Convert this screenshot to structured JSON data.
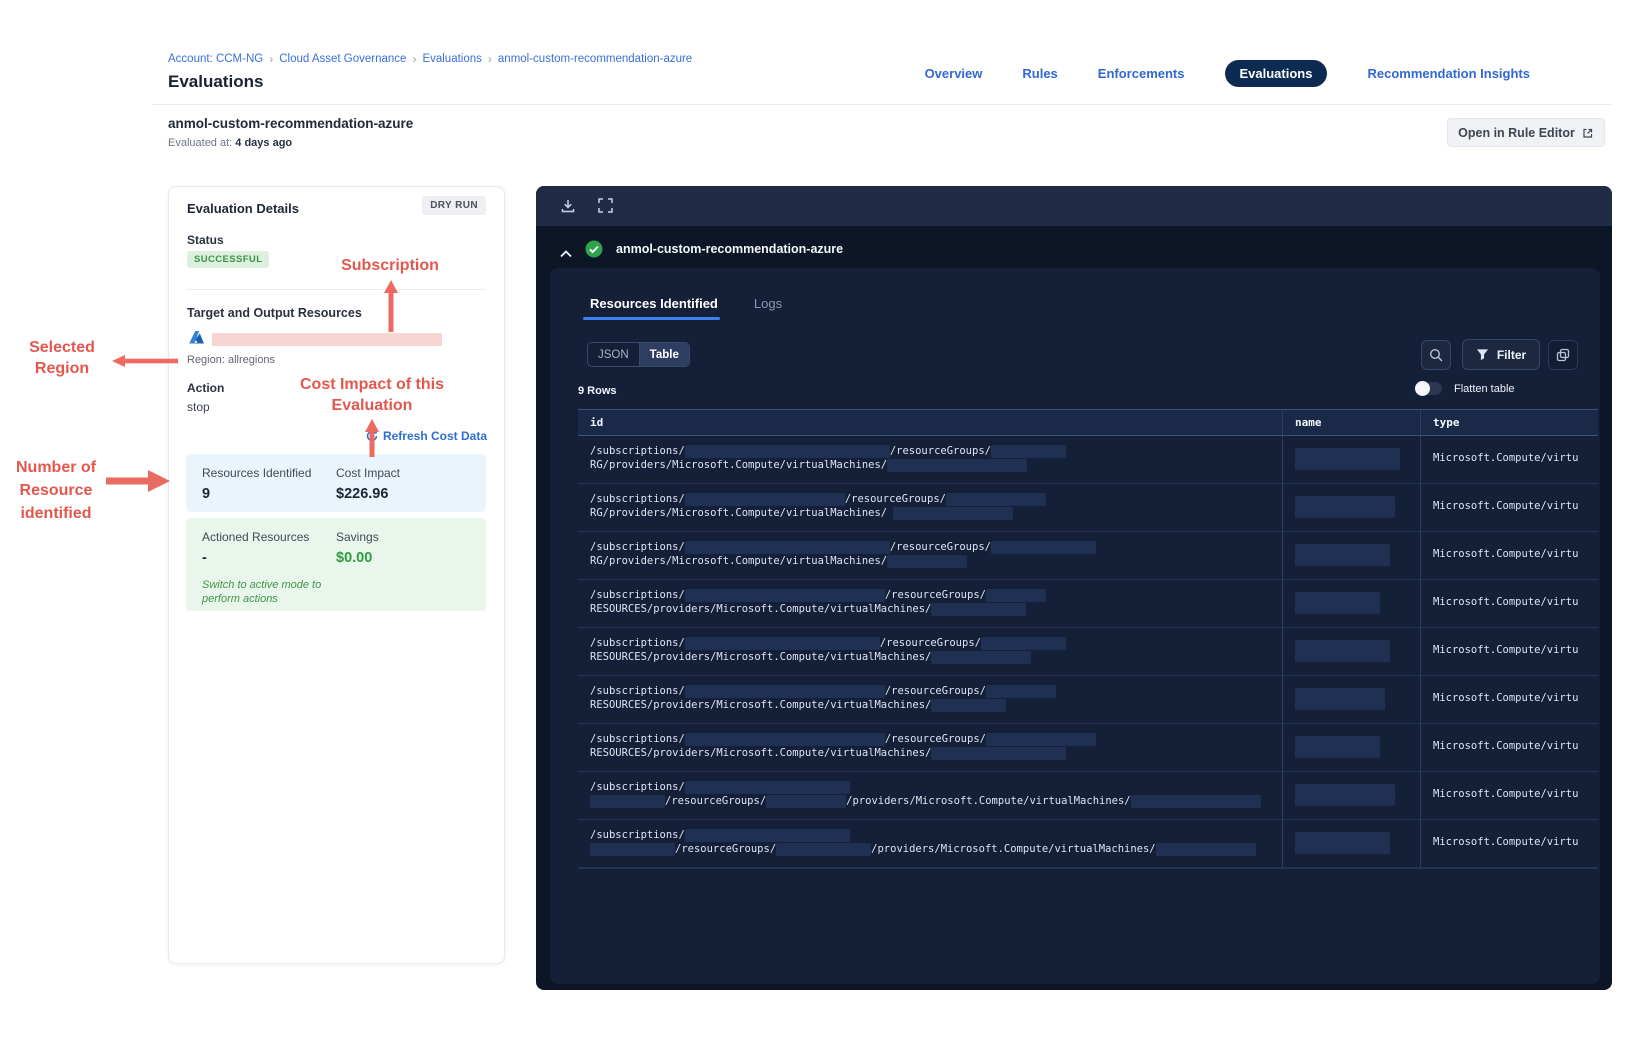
{
  "breadcrumb": {
    "items": [
      "Account: CCM-NG",
      "Cloud Asset Governance",
      "Evaluations",
      "anmol-custom-recommendation-azure"
    ],
    "separator": "›"
  },
  "page_title": "Evaluations",
  "nav": {
    "tabs": [
      {
        "label": "Overview",
        "active": false
      },
      {
        "label": "Rules",
        "active": false
      },
      {
        "label": "Enforcements",
        "active": false
      },
      {
        "label": "Evaluations",
        "active": true
      },
      {
        "label": "Recommendation Insights",
        "active": false
      }
    ]
  },
  "subheader": {
    "title": "anmol-custom-recommendation-azure",
    "evaluated_label": "Evaluated at:",
    "evaluated_value": "4 days ago",
    "open_rule_editor_label": "Open in Rule Editor"
  },
  "details_card": {
    "title": "Evaluation Details",
    "mode_badge": "DRY RUN",
    "status_label": "Status",
    "status_value": "SUCCESSFUL",
    "target_label": "Target and Output Resources",
    "region_text": "Region: allregions",
    "action_label": "Action",
    "action_value": "stop",
    "refresh_link": "Refresh Cost Data",
    "resources_identified_label": "Resources Identified",
    "resources_identified_value": "9",
    "cost_impact_label": "Cost Impact",
    "cost_impact_value": "$226.96",
    "actioned_label": "Actioned Resources",
    "actioned_value": "-",
    "savings_label": "Savings",
    "savings_value": "$0.00",
    "switch_note": "Switch to active mode to perform actions"
  },
  "annotations": {
    "color": "#e4574e",
    "subscription": "Subscription",
    "selected_region": "Selected Region",
    "cost_impact": "Cost Impact of this Evaluation",
    "resources_identified": "Number of Resource identified"
  },
  "results_panel": {
    "title": "anmol-custom-recommendation-azure",
    "tabs": {
      "resources": "Resources Identified",
      "logs": "Logs"
    },
    "view_toggle": {
      "json": "JSON",
      "table": "Table"
    },
    "filter_label": "Filter",
    "rows_count": "9 Rows",
    "flatten_label": "Flatten table",
    "table": {
      "columns": [
        "id",
        "name",
        "type"
      ],
      "type_value": "Microsoft.Compute/virtu",
      "rows": [
        {
          "id1": [
            {
              "t": "/subscriptions/"
            },
            {
              "b": 205
            },
            {
              "t": "/resourceGroups/"
            },
            {
              "b": 75
            }
          ],
          "id2": [
            {
              "t": "RG/providers/Microsoft.Compute/virtualMachines/"
            },
            {
              "b": 140
            }
          ],
          "name_b": 105
        },
        {
          "id1": [
            {
              "t": "/subscriptions/"
            },
            {
              "b": 160
            },
            {
              "t": "/resourceGroups/"
            },
            {
              "b": 100
            }
          ],
          "id2": [
            {
              "t": "RG/providers/Microsoft.Compute/virtualMachines/ "
            },
            {
              "b": 120
            }
          ],
          "name_b": 100
        },
        {
          "id1": [
            {
              "t": "/subscriptions/"
            },
            {
              "b": 205
            },
            {
              "t": "/resourceGroups/"
            },
            {
              "b": 105
            }
          ],
          "id2": [
            {
              "t": "RG/providers/Microsoft.Compute/virtualMachines/"
            },
            {
              "b": 80
            }
          ],
          "name_b": 95
        },
        {
          "id1": [
            {
              "t": "/subscriptions/"
            },
            {
              "b": 200
            },
            {
              "t": "/resourceGroups/"
            },
            {
              "b": 60
            }
          ],
          "id2": [
            {
              "t": "RESOURCES/providers/Microsoft.Compute/virtualMachines/"
            },
            {
              "b": 95
            }
          ],
          "name_b": 85
        },
        {
          "id1": [
            {
              "t": "/subscriptions/"
            },
            {
              "b": 195
            },
            {
              "t": "/resourceGroups/"
            },
            {
              "b": 85
            }
          ],
          "id2": [
            {
              "t": "RESOURCES/providers/Microsoft.Compute/virtualMachines/"
            },
            {
              "b": 100
            }
          ],
          "name_b": 95
        },
        {
          "id1": [
            {
              "t": "/subscriptions/"
            },
            {
              "b": 200
            },
            {
              "t": "/resourceGroups/"
            },
            {
              "b": 70
            }
          ],
          "id2": [
            {
              "t": "RESOURCES/providers/Microsoft.Compute/virtualMachines/"
            },
            {
              "b": 75
            }
          ],
          "name_b": 90
        },
        {
          "id1": [
            {
              "t": "/subscriptions/"
            },
            {
              "b": 200
            },
            {
              "t": "/resourceGroups/"
            },
            {
              "b": 110
            }
          ],
          "id2": [
            {
              "t": "RESOURCES/providers/Microsoft.Compute/virtualMachines/"
            },
            {
              "b": 135
            }
          ],
          "name_b": 85
        },
        {
          "id1": [
            {
              "t": "/subscriptions/"
            },
            {
              "b": 165
            }
          ],
          "id2": [
            {
              "b": 75
            },
            {
              "t": "/resourceGroups/"
            },
            {
              "b": 80
            },
            {
              "t": "/providers/Microsoft.Compute/virtualMachines/"
            },
            {
              "b": 130
            }
          ],
          "name_b": 100
        },
        {
          "id1": [
            {
              "t": "/subscriptions/"
            },
            {
              "b": 165
            }
          ],
          "id2": [
            {
              "b": 85
            },
            {
              "t": "/resourceGroups/"
            },
            {
              "b": 95
            },
            {
              "t": "/providers/Microsoft.Compute/virtualMachines/"
            },
            {
              "b": 100
            }
          ],
          "name_b": 95
        }
      ]
    }
  },
  "colors": {
    "accent_blue": "#3d7ff0",
    "link_blue": "#3168d6",
    "nav_pill": "#0d2a52",
    "panel_dark": "#0c1626",
    "panel_inner": "#141f38",
    "success_green": "#3d9147",
    "savings_green": "#2e9e3f",
    "annotation_red": "#e4574e",
    "pink_redaction": "#f6d4d2",
    "dark_redaction": "#203052"
  }
}
